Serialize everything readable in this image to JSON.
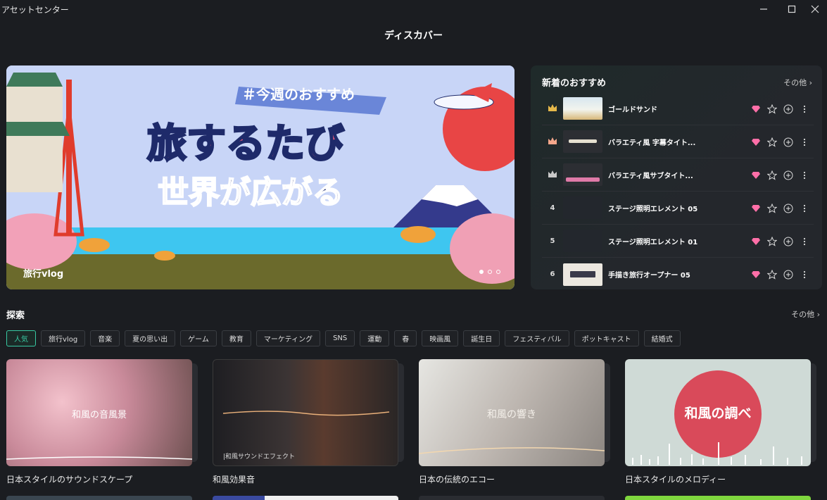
{
  "window": {
    "title": "アセットセンター"
  },
  "page_title": "ディスカバー",
  "banner": {
    "label": "旅行vlog",
    "tag": "＃今週のおすすめ",
    "headline_1": "旅するたび",
    "headline_2": "世界が広がる",
    "active_slide": 1,
    "slides": 3
  },
  "panel": {
    "title": "新着のおすすめ",
    "more": "その他 ›",
    "items": [
      {
        "rank": "crown-gold",
        "name": "ゴールドサンド"
      },
      {
        "rank": "crown-bronze",
        "name": "バラエティ風 字幕タイト..."
      },
      {
        "rank": "crown-silver",
        "name": "バラエティ風サブタイト..."
      },
      {
        "rank": "4",
        "name": "ステージ照明エレメント 05"
      },
      {
        "rank": "5",
        "name": "ステージ照明エレメント 01"
      },
      {
        "rank": "6",
        "name": "手描き旅行オープナー 05"
      }
    ]
  },
  "explore": {
    "title": "探索",
    "more": "その他 ›",
    "chips": [
      "人気",
      "旅行vlog",
      "音楽",
      "夏の思い出",
      "ゲーム",
      "教育",
      "マーケティング",
      "SNS",
      "運動",
      "春",
      "映画風",
      "誕生日",
      "フェスティバル",
      "ポットキャスト",
      "結婚式"
    ],
    "cards": [
      {
        "title": "日本スタイルのサウンドスケープ",
        "overlay": "和風の音風景"
      },
      {
        "title": "和風効果音",
        "overlay": "|和風サウンドエフェクト"
      },
      {
        "title": "日本の伝統のエコー",
        "overlay": "和風の響き"
      },
      {
        "title": "日本スタイルのメロディー",
        "overlay": "和風の調べ"
      }
    ]
  },
  "colors": {
    "accent": "#38c9a3",
    "background": "#1b1d21",
    "gem": "#ff6fa8"
  }
}
